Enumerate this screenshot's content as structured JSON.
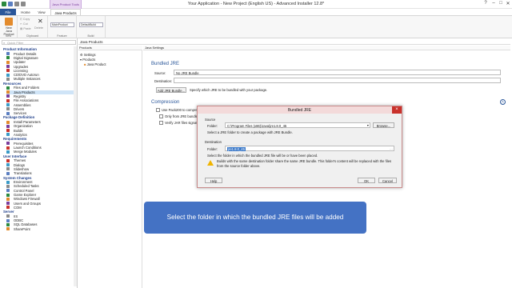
{
  "window": {
    "title": "Your Application - New Project (English US) - Advanced Installer 12.8*",
    "context_tab": "Java Product Tools"
  },
  "tabs": {
    "file": "File",
    "home": "Home",
    "view": "View",
    "java_products": "Java Products"
  },
  "ribbon": {
    "new_label": "New",
    "new_sub": "Java Product",
    "copy": "Copy",
    "cut": "Cut",
    "paste": "Paste",
    "delete": "Delete",
    "clipboard": "Clipboard",
    "new_group": "New",
    "combo1": "MainProduct",
    "combo2": "DefaultBuild",
    "feature": "Feature",
    "build": "Build"
  },
  "left": {
    "search_placeholder": "Quick Filter",
    "sections": [
      {
        "title": "Product Information",
        "items": [
          "Product Details",
          "Digital Signature",
          "Updater",
          "Upgrades",
          "Licensing",
          "CD/DVD Autorun",
          "Multiple Instances"
        ]
      },
      {
        "title": "Resources",
        "items": [
          "Files and Folders",
          "Java Products",
          "Registry",
          "File Associations",
          "Assemblies",
          "Drivers",
          "Services"
        ]
      },
      {
        "title": "Package Definition",
        "items": [
          "Install Parameters",
          "Organization",
          "Builds",
          "Analytics"
        ]
      },
      {
        "title": "Requirements",
        "items": [
          "Prerequisites",
          "Launch Conditions",
          "Merge Modules"
        ]
      },
      {
        "title": "User Interface",
        "items": [
          "Themes",
          "Dialogs",
          "Slideshow",
          "Translations"
        ]
      },
      {
        "title": "System Changes",
        "items": [
          "Environment",
          "Scheduled Tasks",
          "Control Panel",
          "Game Explorer",
          "Windows Firewall",
          "Users and Groups",
          "COM"
        ]
      },
      {
        "title": "Server",
        "items": [
          "IIS",
          "ODBC",
          "SQL Databases",
          "SharePoint"
        ]
      }
    ]
  },
  "center": {
    "header": "Java Products",
    "tree_header": "Products",
    "tree": [
      "Settings",
      "Products",
      "Java Product"
    ],
    "props_header": "Java Settings",
    "bundled_title": "Bundled JRE",
    "source_label": "Source:",
    "source_value": "No JRE Bundle",
    "destination_label": "Destination:",
    "add_button": "Add JRE Bundle...",
    "add_hint": "Specify which JRE to be bundled with your package.",
    "compression_title": "Compression",
    "opt1": "Use Pack200 to compress JAR files",
    "opt2": "Only from JRE bundle",
    "opt3": "Verify JAR files signature"
  },
  "dialog": {
    "title": "Bundled JRE",
    "close": "×",
    "source_group": "Source",
    "folder_label": "Folder:",
    "folder_value": "C:\\Program Files (x86)\\Java\\jre1.8.0_45",
    "browse": "Browse...",
    "source_hint": "Select a JRE folder to create a package with JRE Bundle.",
    "destination_group": "Destination",
    "dest_folder_label": "Folder:",
    "dest_value": "jre1.8.0_45",
    "dest_hint": "Select the folder in which the bundled JRE file will be or have been placed.",
    "warning": "Builds with the same destination folder share the same JRE bundle. This folder's content will be replaced with the files from the source folder above.",
    "help": "Help",
    "ok": "OK",
    "cancel": "Cancel"
  },
  "callout": "Select the folder in which the bundled JRE files will be added",
  "colors": {
    "accent": "#2b579a",
    "callout": "#4472c4",
    "selection": "#cfe4f7",
    "close": "#c9312b"
  }
}
